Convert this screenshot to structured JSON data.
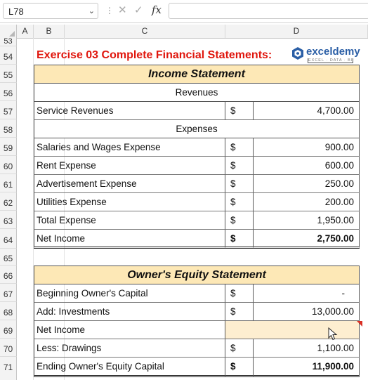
{
  "formula_bar": {
    "name_box": "L78",
    "formula": ""
  },
  "columns": [
    "A",
    "B",
    "C",
    "D"
  ],
  "rows": [
    "53",
    "54",
    "55",
    "56",
    "57",
    "58",
    "59",
    "60",
    "61",
    "62",
    "63",
    "64",
    "65",
    "66",
    "67",
    "68",
    "69",
    "70",
    "71"
  ],
  "title": "Exercise 03 Complete Financial Statements:",
  "logo": {
    "name": "exceldemy",
    "tagline": "EXCEL · DATA · BI"
  },
  "income_statement": {
    "header": "Income Statement",
    "revenues_label": "Revenues",
    "expenses_label": "Expenses",
    "rows": [
      {
        "label": "Service Revenues",
        "currency": "$",
        "amount": "4,700.00"
      },
      {
        "label": "Salaries and Wages Expense",
        "currency": "$",
        "amount": "900.00"
      },
      {
        "label": "Rent Expense",
        "currency": "$",
        "amount": "600.00"
      },
      {
        "label": "Advertisement Expense",
        "currency": "$",
        "amount": "250.00"
      },
      {
        "label": "Utilities Expense",
        "currency": "$",
        "amount": "200.00"
      },
      {
        "label": "Total Expense",
        "currency": "$",
        "amount": "1,950.00"
      },
      {
        "label": "Net Income",
        "currency": "$",
        "amount": "2,750.00"
      }
    ]
  },
  "equity_statement": {
    "header": "Owner's Equity Statement",
    "rows": [
      {
        "label": "Beginning Owner's Capital",
        "currency": "$",
        "amount": "-"
      },
      {
        "label": "Add: Investments",
        "currency": "$",
        "amount": "13,000.00"
      },
      {
        "label": "Net Income",
        "currency": "",
        "amount": ""
      },
      {
        "label": "Less: Drawings",
        "currency": "$",
        "amount": "1,100.00"
      },
      {
        "label": "Ending Owner's Equity Capital",
        "currency": "$",
        "amount": "11,900.00"
      }
    ]
  },
  "colors": {
    "title": "#e0160d",
    "header_fill": "#fde8b6",
    "selected_fill": "#fdeed0",
    "logo": "#2b5fa6"
  }
}
